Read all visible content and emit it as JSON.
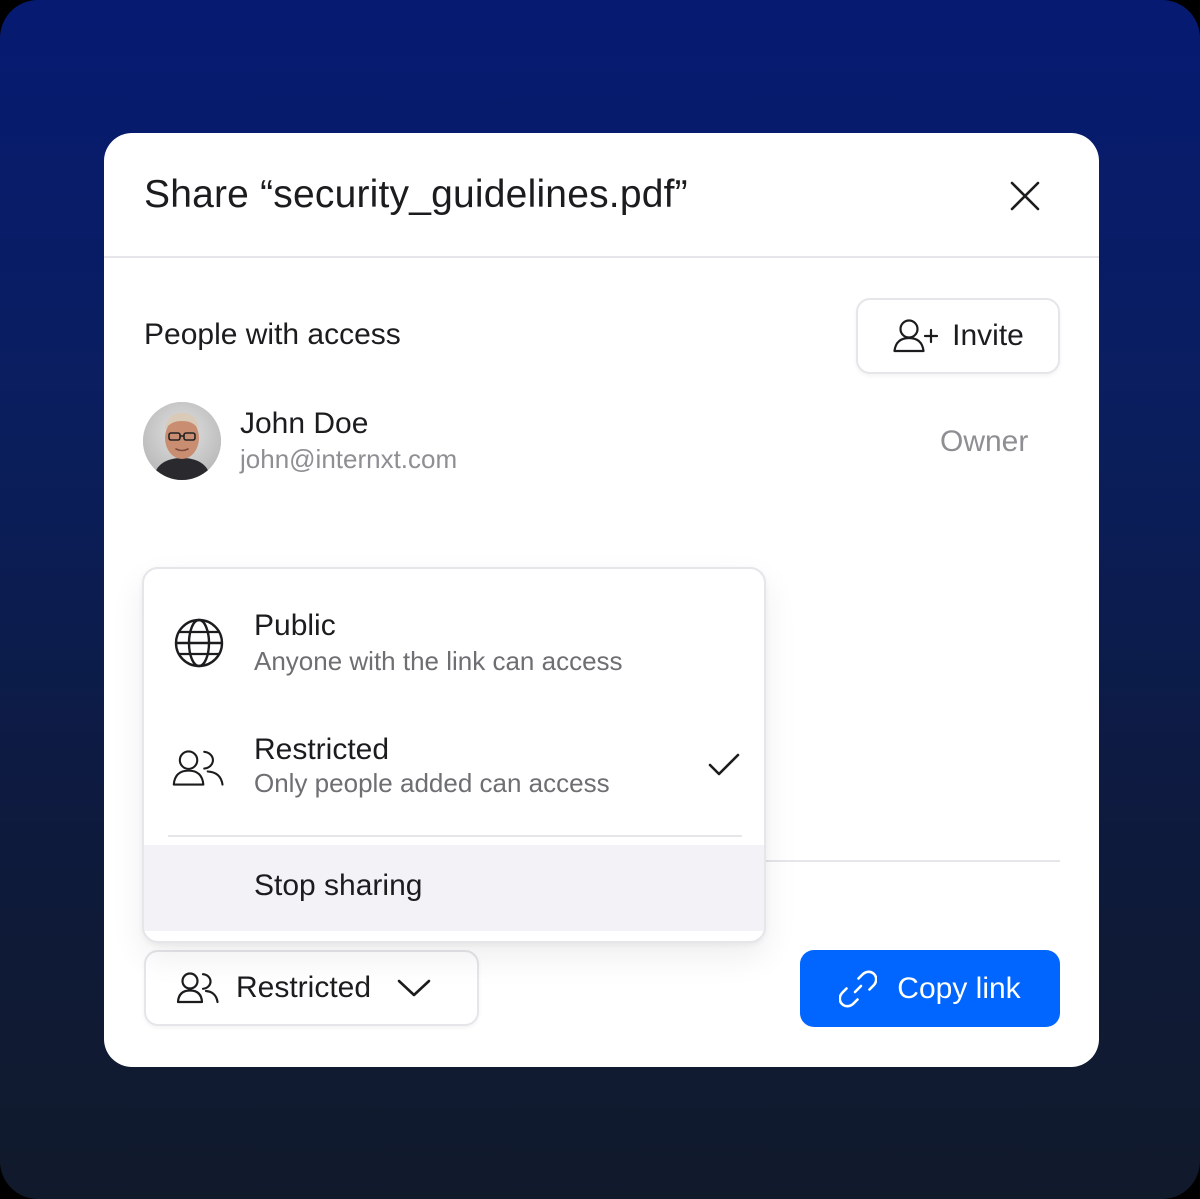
{
  "dialog": {
    "title": "Share “security_guidelines.pdf”",
    "close_icon": "close-icon"
  },
  "access": {
    "section_label": "People with access",
    "invite_label": "Invite",
    "invite_icon": "add-user-icon"
  },
  "users": [
    {
      "name": "John Doe",
      "email": "john@internxt.com",
      "role": "Owner",
      "avatar": "avatar-photo"
    }
  ],
  "menu": {
    "options": [
      {
        "title": "Public",
        "description": "Anyone with the link can access",
        "icon": "globe-icon",
        "selected": false
      },
      {
        "title": "Restricted",
        "description": "Only people added can access",
        "icon": "users-icon",
        "selected": true
      }
    ],
    "stop_sharing_label": "Stop sharing"
  },
  "footer": {
    "access_level_label": "Restricted",
    "access_level_icon": "users-icon",
    "copy_link_label": "Copy link",
    "copy_link_icon": "link-icon"
  },
  "colors": {
    "accent": "#0066ff",
    "background_top": "#061a72",
    "background_bottom": "#111a2b",
    "text_primary": "#1c1c1e",
    "text_secondary": "#8e8e93"
  }
}
